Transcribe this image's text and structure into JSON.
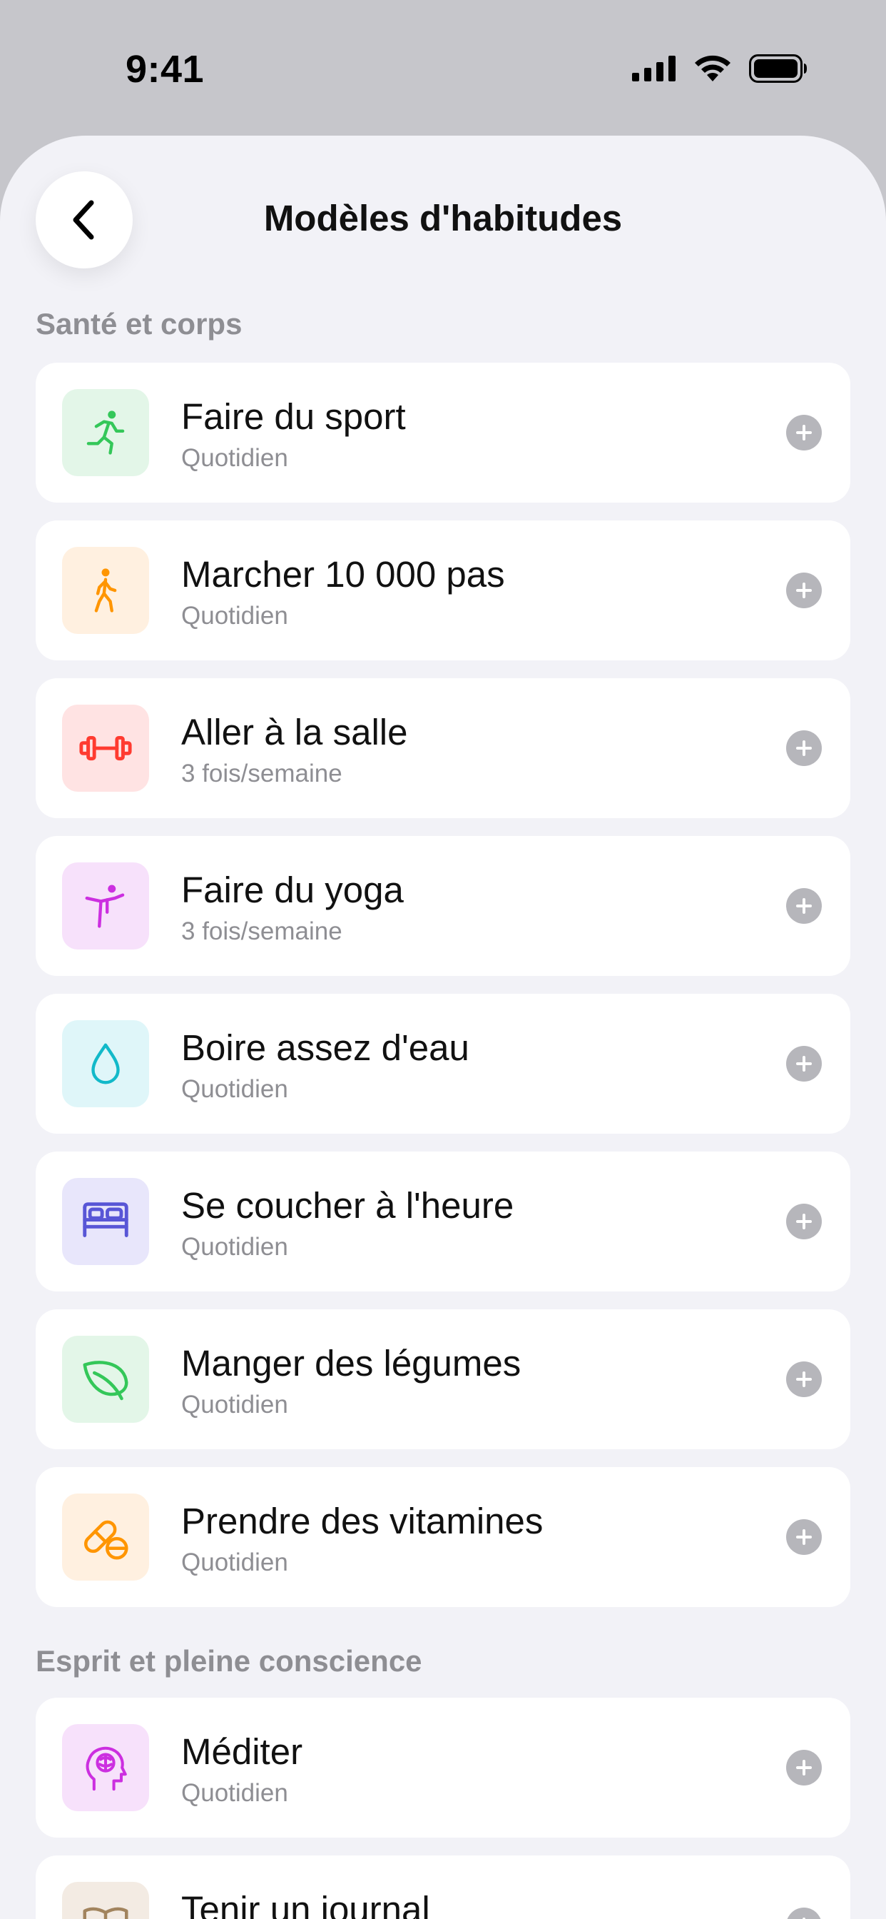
{
  "status": {
    "time": "9:41"
  },
  "header": {
    "title": "Modèles d'habitudes"
  },
  "sections": [
    {
      "title": "Santé et corps"
    },
    {
      "title": "Esprit et pleine conscience"
    }
  ],
  "habits": [
    {
      "title": "Faire du sport",
      "frequency": "Quotidien",
      "icon": "running-icon",
      "color": "#34c759",
      "tint": "#e3f6e8"
    },
    {
      "title": "Marcher 10 000 pas",
      "frequency": "Quotidien",
      "icon": "walking-icon",
      "color": "#ff9500",
      "tint": "#fff0e0"
    },
    {
      "title": "Aller à la salle",
      "frequency": "3 fois/semaine",
      "icon": "dumbbell-icon",
      "color": "#ff3b30",
      "tint": "#ffe3e3"
    },
    {
      "title": "Faire du yoga",
      "frequency": "3 fois/semaine",
      "icon": "yoga-icon",
      "color": "#cc2fe0",
      "tint": "#f7e1fb"
    },
    {
      "title": "Boire assez d'eau",
      "frequency": "Quotidien",
      "icon": "water-drop-icon",
      "color": "#12b9c9",
      "tint": "#dff6f9"
    },
    {
      "title": "Se coucher à l'heure",
      "frequency": "Quotidien",
      "icon": "bed-icon",
      "color": "#5856d6",
      "tint": "#e8e6fb"
    },
    {
      "title": "Manger des légumes",
      "frequency": "Quotidien",
      "icon": "leaf-icon",
      "color": "#34c759",
      "tint": "#e3f6e8"
    },
    {
      "title": "Prendre des vitamines",
      "frequency": "Quotidien",
      "icon": "pills-icon",
      "color": "#ff9500",
      "tint": "#fff0e0"
    },
    {
      "title": "Méditer",
      "frequency": "Quotidien",
      "icon": "brain-head-icon",
      "color": "#cc2fe0",
      "tint": "#f7e1fb"
    },
    {
      "title": "Tenir un journal",
      "frequency": "",
      "icon": "journal-icon",
      "color": "#a2845e",
      "tint": "#f3ebe3"
    }
  ]
}
